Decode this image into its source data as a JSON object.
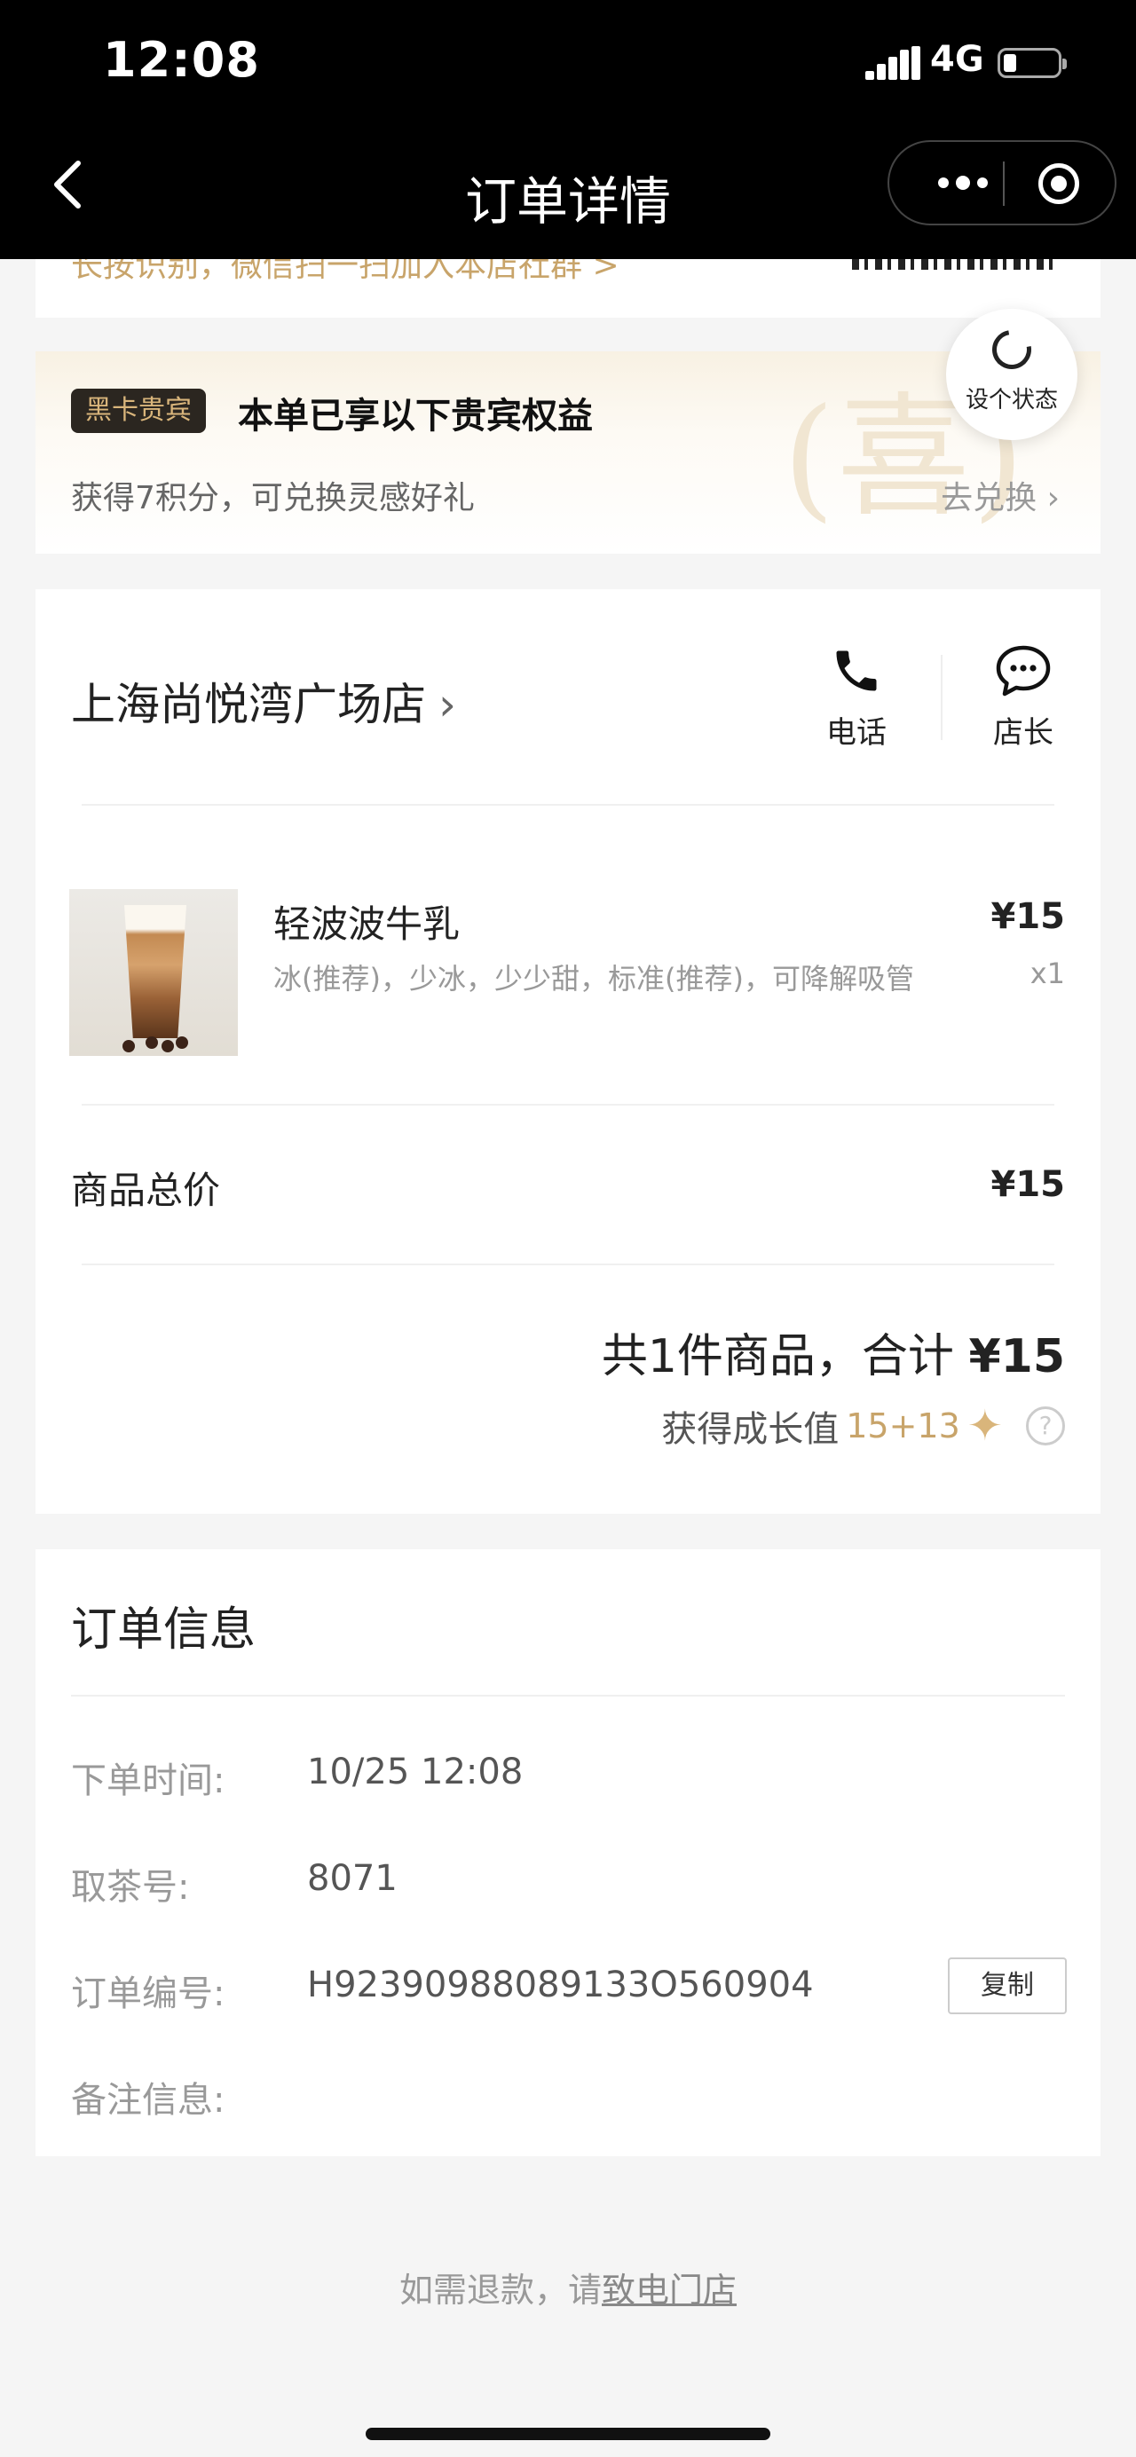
{
  "status_bar": {
    "time": "12:08",
    "network": "4G"
  },
  "nav": {
    "title": "订单详情"
  },
  "scan_banner": {
    "text": "长按识别，微信扫一扫加入本店社群 >"
  },
  "vip": {
    "badge": "黑卡贵宾",
    "title": "本单已享以下贵宾权益",
    "desc": "获得7积分，可兑换灵感好礼",
    "seal_char": "喜",
    "link": "去兑换 ›"
  },
  "status_button": {
    "label": "设个状态"
  },
  "store": {
    "name": "上海尚悦湾广场店",
    "chevron": "›",
    "phone_label": "电话",
    "chat_label": "店长"
  },
  "item": {
    "name": "轻波波牛乳",
    "spec": "冰(推荐)，少冰，少少甜，标准(推荐)，可降解吸管",
    "price": "¥15",
    "qty": "x1"
  },
  "subtotal": {
    "label": "商品总价",
    "value": "¥15"
  },
  "total": {
    "prefix": "共1件商品，合计 ",
    "amount": "¥15"
  },
  "growth": {
    "label": "获得成长值",
    "value": "15+13",
    "help": "?"
  },
  "order_info": {
    "title": "订单信息",
    "rows": [
      {
        "key": "下单时间:",
        "value": "10/25 12:08"
      },
      {
        "key": "取茶号:",
        "value": "8071"
      },
      {
        "key": "订单编号:",
        "value": "H92390988089133O560904"
      },
      {
        "key": "备注信息:",
        "value": ""
      }
    ],
    "copy_label": "复制"
  },
  "refund": {
    "prefix": "如需退款，请",
    "link": "致电门店"
  },
  "colors": {
    "gold": "#c8a46a",
    "dark": "#2b2620",
    "nav_bg": "#000000"
  }
}
